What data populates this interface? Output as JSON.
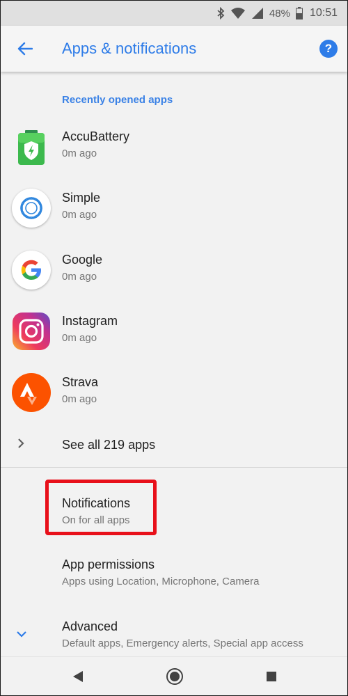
{
  "status_bar": {
    "battery_percent": "48%",
    "time": "10:51",
    "icons": [
      "bluetooth-icon",
      "wifi-icon",
      "signal-icon",
      "battery-icon"
    ]
  },
  "app_bar": {
    "title": "Apps & notifications",
    "back_icon": "arrow-left-icon",
    "help_icon": "help-icon",
    "accent": "#2e7ce8"
  },
  "recent": {
    "header": "Recently opened apps",
    "apps": [
      {
        "name": "AccuBattery",
        "time": "0m ago",
        "icon": "accubattery-icon"
      },
      {
        "name": "Simple",
        "time": "0m ago",
        "icon": "simple-icon"
      },
      {
        "name": "Google",
        "time": "0m ago",
        "icon": "google-icon"
      },
      {
        "name": "Instagram",
        "time": "0m ago",
        "icon": "instagram-icon"
      },
      {
        "name": "Strava",
        "time": "0m ago",
        "icon": "strava-icon"
      }
    ],
    "see_all": "See all 219 apps"
  },
  "settings": {
    "notifications": {
      "title": "Notifications",
      "summary": "On for all apps"
    },
    "app_permissions": {
      "title": "App permissions",
      "summary": "Apps using Location, Microphone, Camera"
    },
    "advanced": {
      "title": "Advanced",
      "summary": "Default apps, Emergency alerts, Special app access"
    }
  },
  "highlight_color": "#e8101a",
  "nav_bar": {
    "icons": [
      "back-triangle-icon",
      "home-circle-icon",
      "recents-square-icon"
    ]
  }
}
